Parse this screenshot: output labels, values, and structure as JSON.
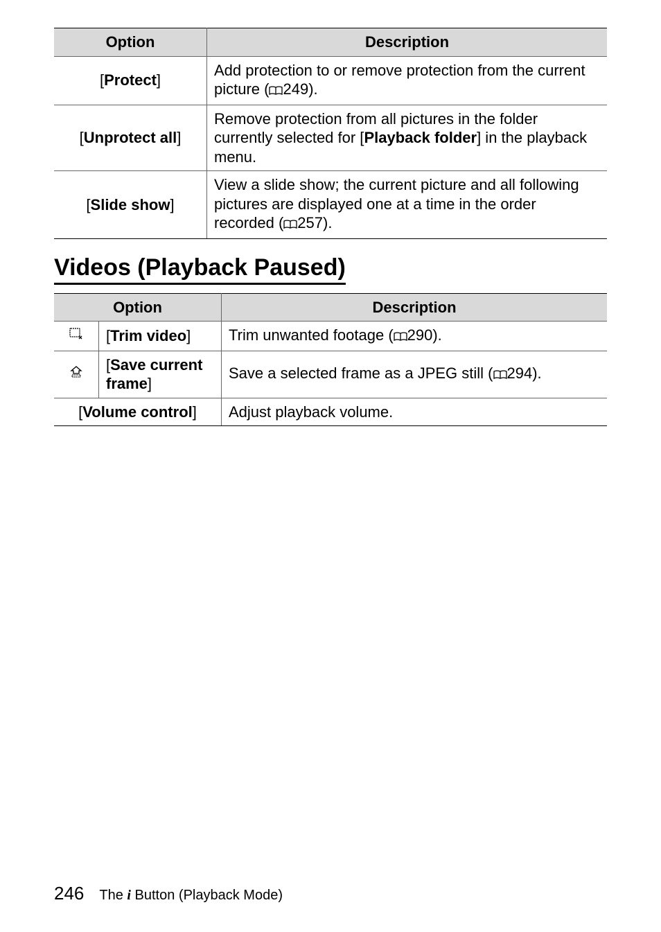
{
  "table1": {
    "headers": {
      "option": "Option",
      "description": "Description"
    },
    "rows": [
      {
        "option_open": "[",
        "option_label": "Protect",
        "option_close": "]",
        "desc_before": "Add protection to or remove protection from the current picture (",
        "desc_page": "249).",
        "has_bold_mid": false
      },
      {
        "option_open": "[",
        "option_label": "Unprotect all",
        "option_close": "]",
        "desc_before": "Remove protection from all pictures in the folder currently selected for [",
        "desc_bold_mid": "Playback folder",
        "desc_after": "] in the playback menu.",
        "has_bold_mid": true
      },
      {
        "option_open": "[",
        "option_label": "Slide show",
        "option_close": "]",
        "desc_before": "View a slide show; the current picture and all following pictures are displayed one at a time in the order recorded (",
        "desc_page": "257).",
        "has_bold_mid": false
      }
    ]
  },
  "heading2": "Videos (Playback Paused)",
  "table2": {
    "headers": {
      "option": "Option",
      "description": "Description"
    },
    "rows": [
      {
        "icon": "trim",
        "option_open": "[",
        "option_label": "Trim video",
        "option_close": "]",
        "desc_before": "Trim unwanted footage (",
        "desc_page": "290)."
      },
      {
        "icon": "frame",
        "option_open": "[",
        "option_label": "Save current frame",
        "option_close": "]",
        "desc_before": "Save a selected frame as a JPEG still (",
        "desc_page": "294)."
      },
      {
        "merged": true,
        "option_open": "[",
        "option_label": "Volume control",
        "option_close": "]",
        "desc_plain": "Adjust playback volume."
      }
    ]
  },
  "footer": {
    "page_number": "246",
    "chapter_prefix": "The ",
    "chapter_i": "i",
    "chapter_suffix": " Button (Playback Mode)"
  }
}
